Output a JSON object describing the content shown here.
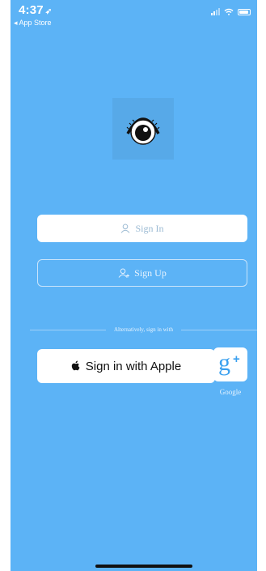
{
  "status_bar": {
    "time": "4:37",
    "back_label": "◂ App Store"
  },
  "auth": {
    "signin_label": "Sign In",
    "signup_label": "Sign Up"
  },
  "divider_text": "Alternatively, sign in with",
  "apple": {
    "label": "Sign in with Apple"
  },
  "google": {
    "label": "Google"
  },
  "icons": {
    "location": "location-arrow-icon",
    "signal": "signal-icon",
    "wifi": "wifi-icon",
    "battery": "battery-icon",
    "logo": "eye-logo-icon",
    "user": "user-icon",
    "add_user": "add-user-icon",
    "apple": "apple-icon",
    "google_plus": "google-plus-icon"
  },
  "colors": {
    "background": "#5cb3f6",
    "button_text": "#9bbad3",
    "google_blue": "#3aa0ef"
  }
}
